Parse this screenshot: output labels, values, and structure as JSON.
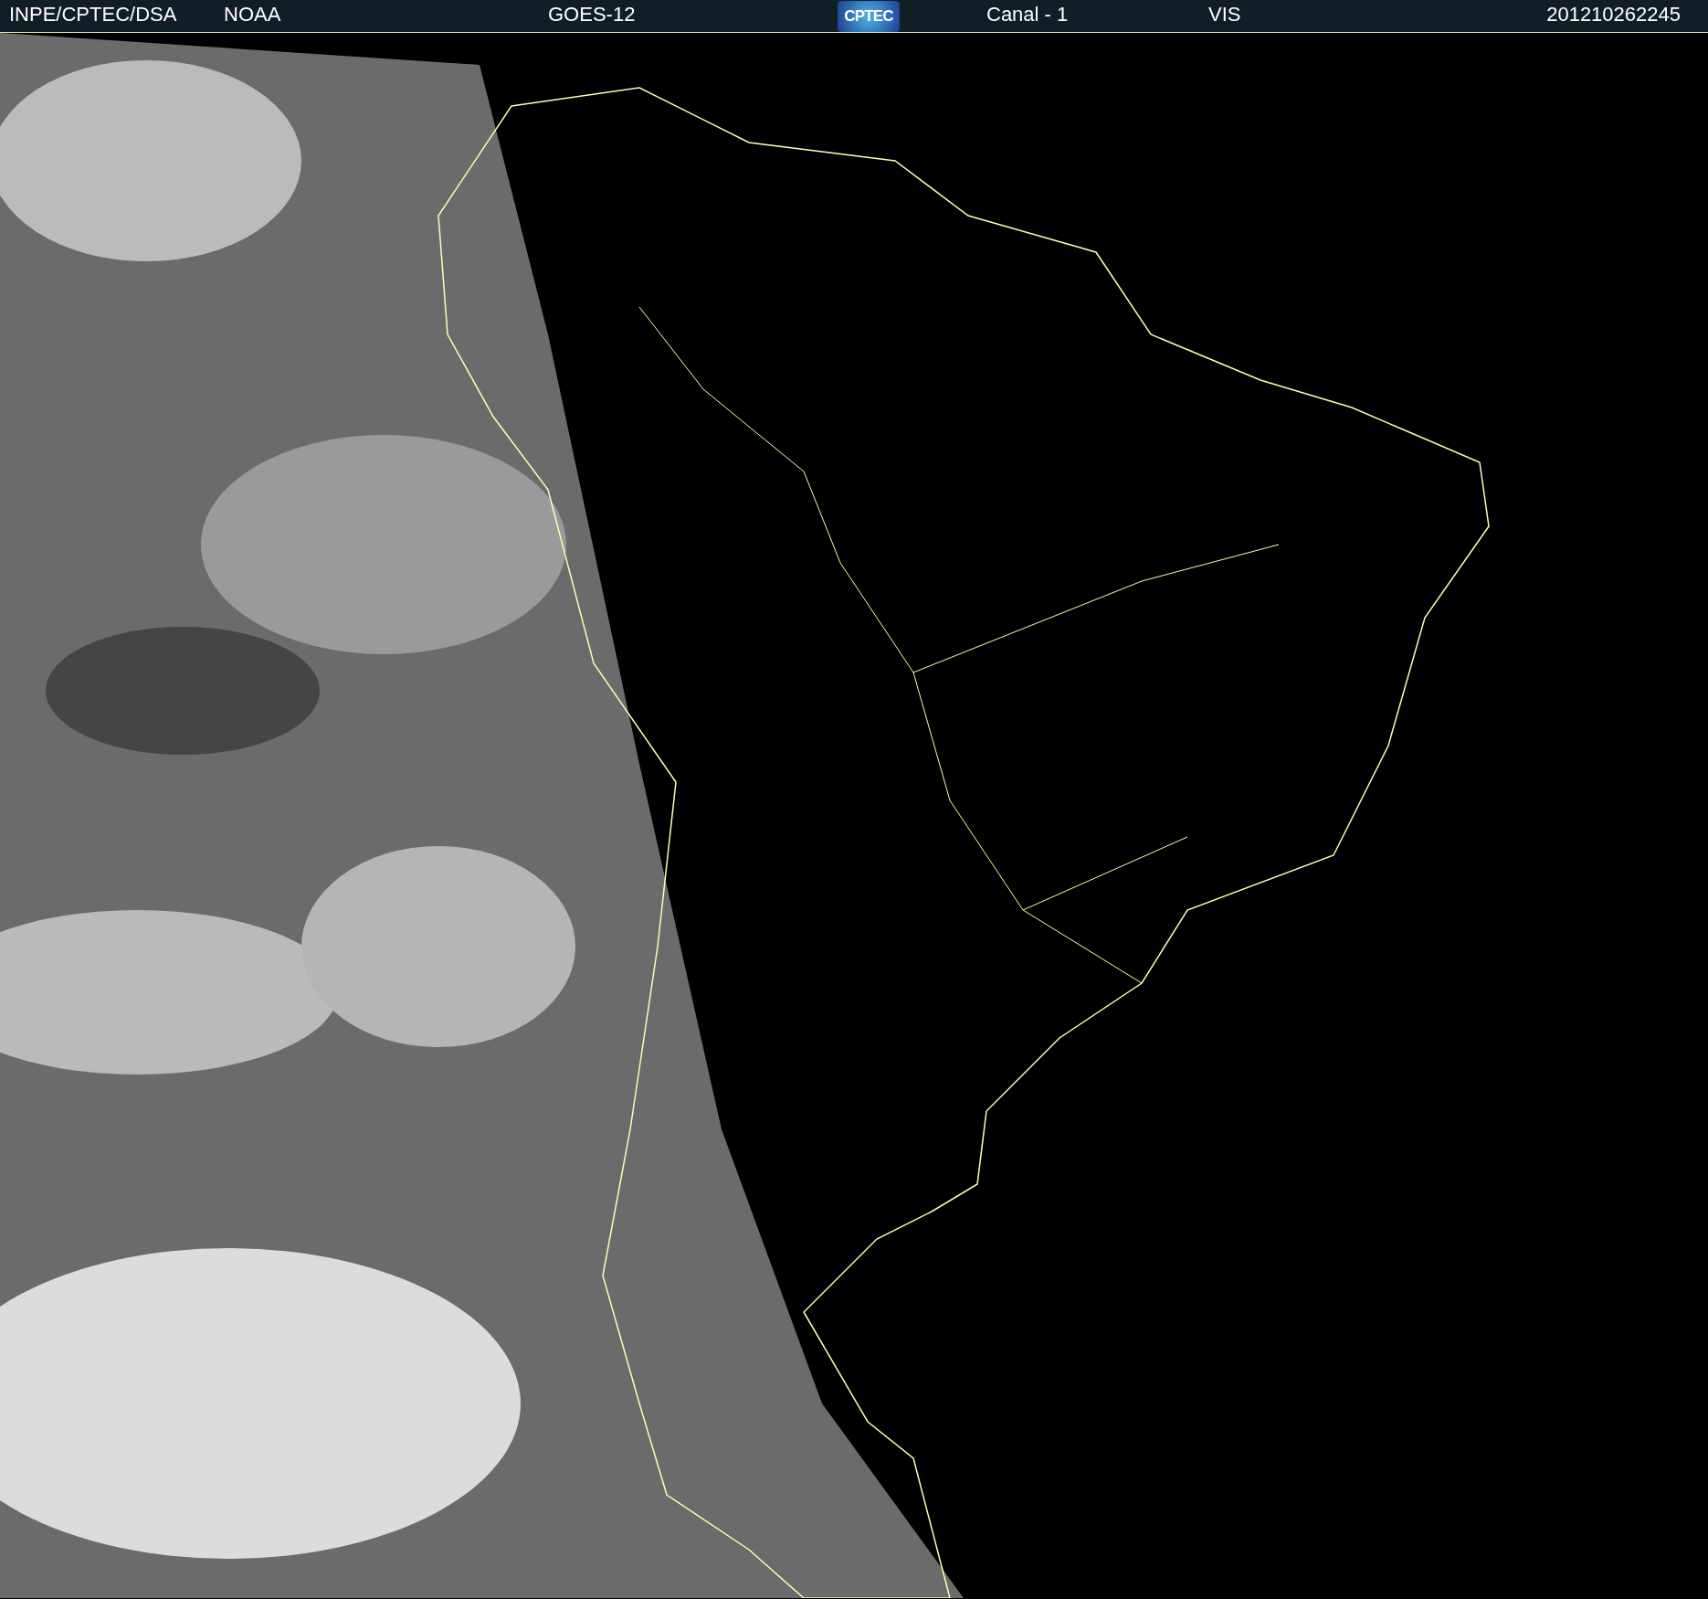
{
  "header": {
    "items": [
      {
        "kind": "text",
        "text": "INPE/CPTEC/DSA"
      },
      {
        "kind": "text",
        "text": "NOAA"
      },
      {
        "kind": "text",
        "text": "GOES-12"
      },
      {
        "kind": "logo",
        "text": "CPTEC"
      },
      {
        "kind": "text",
        "text": "Canal - 1"
      },
      {
        "kind": "text",
        "text": "VIS"
      },
      {
        "kind": "text",
        "text": "201210262245"
      }
    ]
  }
}
